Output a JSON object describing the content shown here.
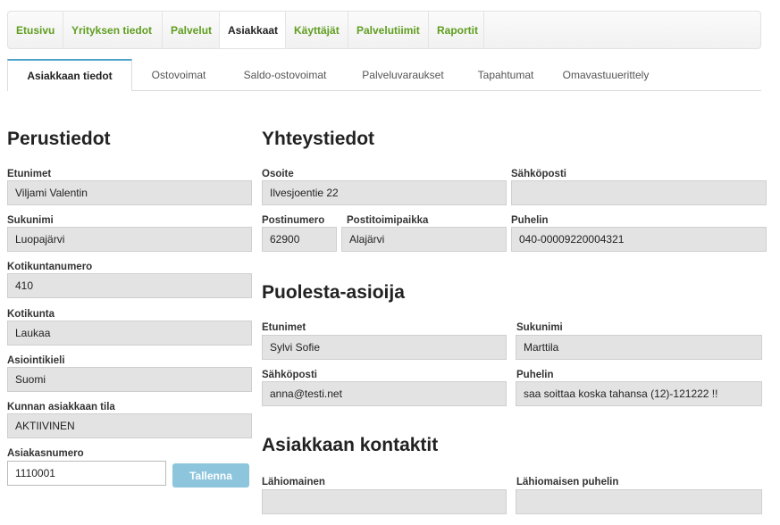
{
  "topnav": {
    "items": [
      {
        "label": "Etusivu"
      },
      {
        "label": "Yrityksen tiedot"
      },
      {
        "label": "Palvelut"
      },
      {
        "label": "Asiakkaat"
      },
      {
        "label": "Käyttäjät"
      },
      {
        "label": "Palvelutiimit"
      },
      {
        "label": "Raportit"
      }
    ],
    "active_index": 3
  },
  "subtabs": {
    "items": [
      {
        "label": "Asiakkaan tiedot"
      },
      {
        "label": "Ostovoimat"
      },
      {
        "label": "Saldo-ostovoimat"
      },
      {
        "label": "Palveluvaraukset"
      },
      {
        "label": "Tapahtumat"
      },
      {
        "label": "Omavastuuerittely"
      }
    ],
    "active_index": 0
  },
  "perustiedot": {
    "heading": "Perustiedot",
    "etunimet_label": "Etunimet",
    "etunimet": "Viljami Valentin",
    "sukunimi_label": "Sukunimi",
    "sukunimi": "Luopajärvi",
    "kotikuntanumero_label": "Kotikuntanumero",
    "kotikuntanumero": "410",
    "kotikunta_label": "Kotikunta",
    "kotikunta": "Laukaa",
    "asiointikieli_label": "Asiointikieli",
    "asiointikieli": "Suomi",
    "tila_label": "Kunnan asiakkaan tila",
    "tila": "AKTIIVINEN",
    "asiakasnumero_label": "Asiakasnumero",
    "asiakasnumero": "1110001",
    "save_label": "Tallenna"
  },
  "yhteystiedot": {
    "heading": "Yhteystiedot",
    "osoite_label": "Osoite",
    "osoite": "Ilvesjoentie 22",
    "sahkoposti_label": "Sähköposti",
    "sahkoposti": "",
    "postinumero_label": "Postinumero",
    "postinumero": "62900",
    "postitoimipaikka_label": "Postitoimipaikka",
    "postitoimipaikka": "Alajärvi",
    "puhelin_label": "Puhelin",
    "puhelin": "040-00009220004321"
  },
  "puolesta": {
    "heading": "Puolesta-asioija",
    "etunimet_label": "Etunimet",
    "etunimet": "Sylvi Sofie",
    "sukunimi_label": "Sukunimi",
    "sukunimi": "Marttila",
    "sahkoposti_label": "Sähköposti",
    "sahkoposti": "anna@testi.net",
    "puhelin_label": "Puhelin",
    "puhelin": "saa soittaa koska tahansa (12)-121222  !!"
  },
  "kontaktit": {
    "heading": "Asiakkaan kontaktit",
    "lahiomainen_label": "Lähiomainen",
    "lahiomainen": "",
    "lahiomaisen_puhelin_label": "Lähiomaisen puhelin",
    "lahiomaisen_puhelin": ""
  }
}
